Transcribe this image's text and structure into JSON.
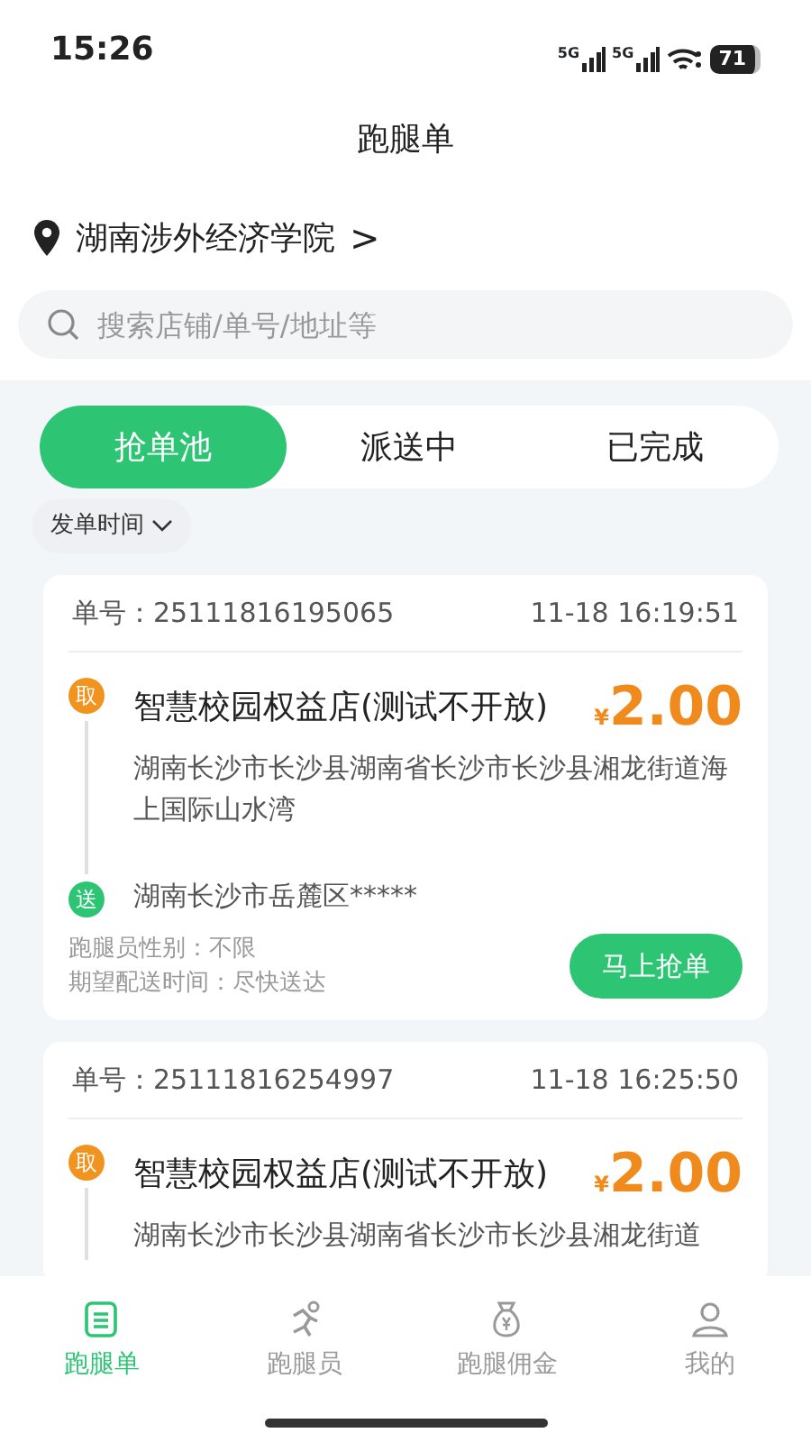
{
  "status_bar": {
    "time": "15:26",
    "networks": [
      "5G",
      "5G"
    ],
    "battery": "71"
  },
  "header": {
    "title": "跑腿单"
  },
  "location": {
    "name": "湖南涉外经济学院",
    "chevron": ">"
  },
  "search": {
    "placeholder": "搜索店铺/单号/地址等"
  },
  "tabs": [
    {
      "label": "抢单池",
      "selected": true
    },
    {
      "label": "派送中",
      "selected": false
    },
    {
      "label": "已完成",
      "selected": false
    }
  ],
  "sort": {
    "label": "发单时间"
  },
  "orders": [
    {
      "number_label": "单号：",
      "number": "25111816195065",
      "time": "11-18 16:19:51",
      "pickup": {
        "marker": "取",
        "store": "智慧校园权益店(测试不开放)",
        "address": "湖南长沙市长沙县湖南省长沙市长沙县湘龙街道海上国际山水湾"
      },
      "currency": "¥",
      "price": "2.00",
      "delivery": {
        "marker": "送",
        "address": "湖南长沙市岳麓区*****"
      },
      "gender": "跑腿员性别：不限",
      "expected": "期望配送时间：尽快送达",
      "action": "马上抢单"
    },
    {
      "number_label": "单号：",
      "number": "25111816254997",
      "time": "11-18 16:25:50",
      "pickup": {
        "marker": "取",
        "store": "智慧校园权益店(测试不开放)",
        "address": "湖南长沙市长沙县湖南省长沙市长沙县湘龙街道"
      },
      "currency": "¥",
      "price": "2.00"
    }
  ],
  "bottom_nav": [
    {
      "label": "跑腿单",
      "kind": "orders",
      "selected": true
    },
    {
      "label": "跑腿员",
      "kind": "runner",
      "selected": false
    },
    {
      "label": "跑腿佣金",
      "kind": "money",
      "selected": false
    },
    {
      "label": "我的",
      "kind": "profile",
      "selected": false
    }
  ]
}
